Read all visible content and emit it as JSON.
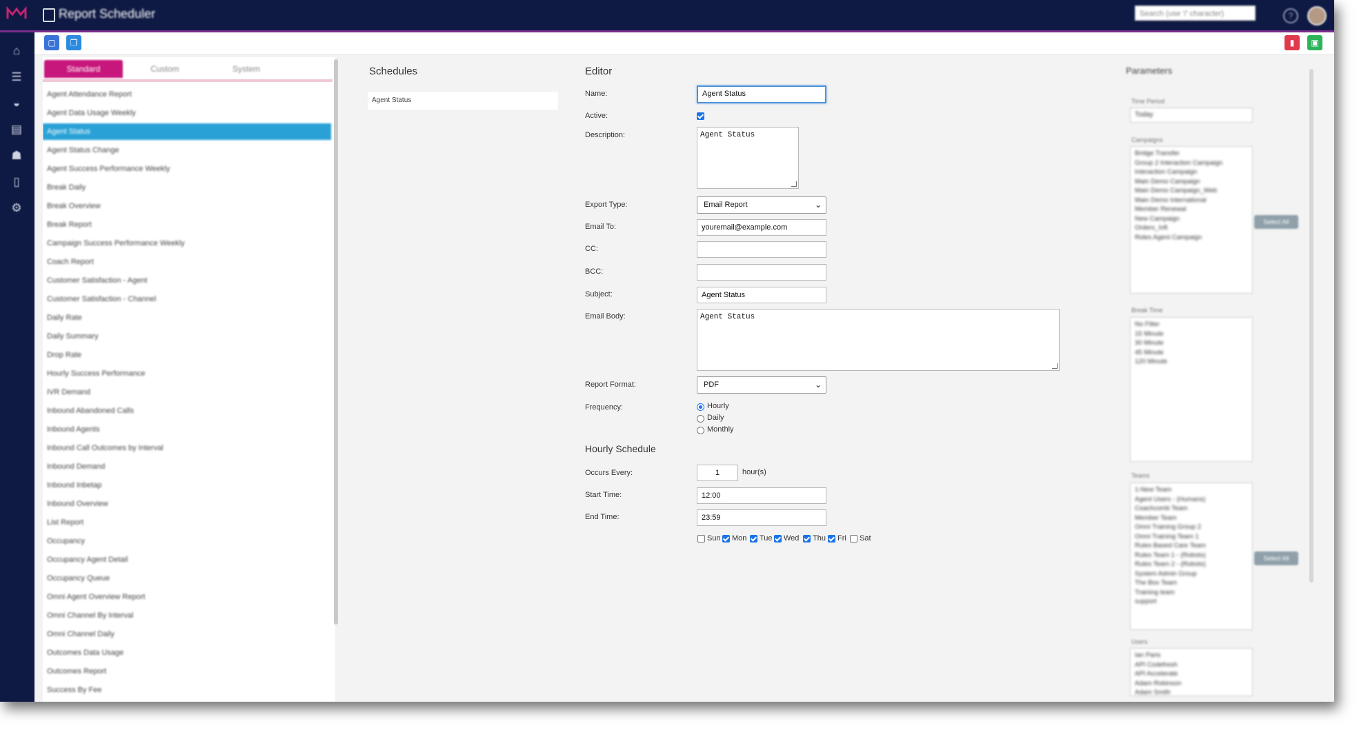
{
  "header": {
    "title": "Report Scheduler",
    "search_placeholder": "Search (use '/' character)"
  },
  "toolbar": {
    "left_buttons": [
      "new-icon",
      "copy-icon"
    ],
    "right_buttons": [
      "delete-icon",
      "save-icon"
    ],
    "colors": {
      "new": "#3a73d8",
      "copy": "#2a8be0",
      "delete": "#e0384c",
      "save": "#2fb35a"
    }
  },
  "report_list": {
    "tabs": [
      "Standard",
      "Custom",
      "System"
    ],
    "active_tab": "Standard",
    "selected": "Agent Status",
    "items": [
      "Agent Attendance Report",
      "Agent Data Usage Weekly",
      "Agent Status",
      "Agent Status Change",
      "Agent Success Performance Weekly",
      "Break Daily",
      "Break Overview",
      "Break Report",
      "Campaign Success Performance Weekly",
      "Coach Report",
      "Customer Satisfaction - Agent",
      "Customer Satisfaction - Channel",
      "Daily Rate",
      "Daily Summary",
      "Drop Rate",
      "Hourly Success Performance",
      "IVR Demand",
      "Inbound Abandoned Calls",
      "Inbound Agents",
      "Inbound Call Outcomes by Interval",
      "Inbound Demand",
      "Inbound Inbetap",
      "Inbound Overview",
      "List Report",
      "Occupancy",
      "Occupancy Agent Detail",
      "Occupancy Queue",
      "Omni Agent Overview Report",
      "Omni Channel By Interval",
      "Omni Channel Daily",
      "Outcomes Data Usage",
      "Outcomes Report",
      "Success By Fee"
    ]
  },
  "schedules": {
    "heading": "Schedules",
    "items": [
      "Agent Status"
    ]
  },
  "editor": {
    "heading": "Editor",
    "labels": {
      "name": "Name:",
      "active": "Active:",
      "description": "Description:",
      "export_type": "Export Type:",
      "email_to": "Email To:",
      "cc": "CC:",
      "bcc": "BCC:",
      "subject": "Subject:",
      "email_body": "Email Body:",
      "report_format": "Report Format:",
      "frequency": "Frequency:"
    },
    "values": {
      "name": "Agent Status",
      "active": true,
      "description": "Agent Status",
      "export_type": "Email Report",
      "email_to": "youremail@example.com",
      "cc": "",
      "bcc": "",
      "subject": "Agent Status",
      "email_body": "Agent Status",
      "report_format": "PDF"
    },
    "frequency_options": [
      "Hourly",
      "Daily",
      "Monthly"
    ],
    "frequency_selected": "Hourly"
  },
  "hourly_schedule": {
    "heading": "Hourly Schedule",
    "labels": {
      "occurs_every": "Occurs Every:",
      "start_time": "Start Time:",
      "end_time": "End Time:",
      "unit": "hour(s)"
    },
    "occurs_every": "1",
    "start_time": "12:00",
    "end_time": "23:59",
    "days": [
      {
        "label": "Sun",
        "checked": false
      },
      {
        "label": "Mon",
        "checked": true
      },
      {
        "label": "Tue",
        "checked": true
      },
      {
        "label": "Wed",
        "checked": true
      },
      {
        "label": "Thu",
        "checked": true
      },
      {
        "label": "Fri",
        "checked": true
      },
      {
        "label": "Sat",
        "checked": false
      }
    ]
  },
  "parameters": {
    "heading": "Parameters",
    "time_period_label": "Time Period",
    "time_period_value": "Today",
    "campaigns_label": "Campaigns",
    "campaigns": [
      "Bridge Transfer",
      "Group 2 Interaction Campaign",
      "Interaction Campaign",
      "Main Demo Campaign",
      "Main Demo Campaign_Web",
      "Main Demo International",
      "Member Renewal",
      "New Campaign",
      "Orders_Inft",
      "Roles Agent Campaign"
    ],
    "break_time_label": "Break Time",
    "break_times": [
      "No Filter",
      "15 Minute",
      "30 Minute",
      "45 Minute",
      "120 Minute"
    ],
    "teams_label": "Teams",
    "teams": [
      "1-New Team",
      "Agent Users - (Humans)",
      "Coachcomb Team",
      "Member Team",
      "Omni Training Group 2",
      "Omni Training Team 1",
      "Rules Based Care Team",
      "Rules Team 1 - (Robots)",
      "Rules Team 2 - (Robots)",
      "System Admin Group",
      "The Box Team",
      "Training team",
      "support"
    ],
    "users_label": "Users",
    "users": [
      "Ian Paris",
      "API Codefresh",
      "API Accelerate",
      "Adam Robinson",
      "Adam Smith"
    ],
    "select_all": "Select All"
  }
}
